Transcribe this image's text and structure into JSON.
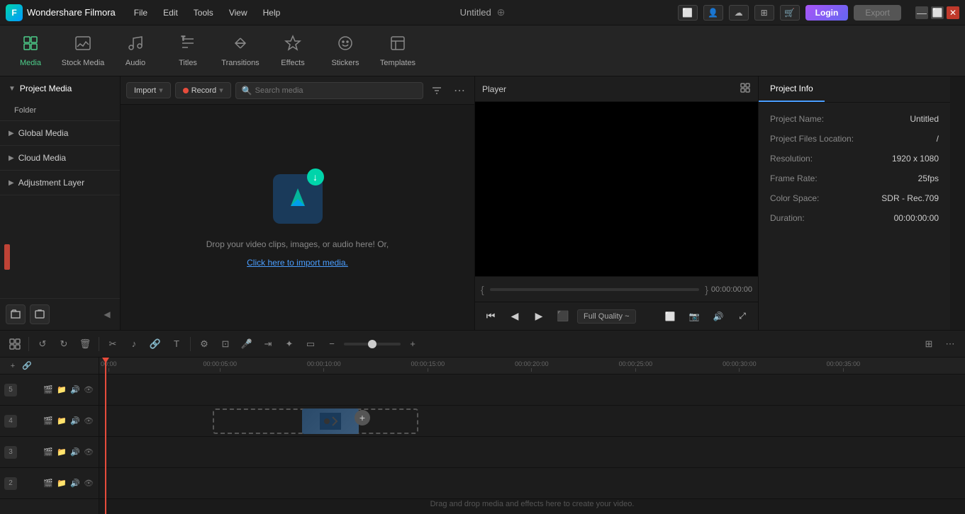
{
  "app": {
    "name": "Wondershare Filmora",
    "title": "Untitled"
  },
  "menu": {
    "items": [
      "File",
      "Edit",
      "Tools",
      "View",
      "Help"
    ]
  },
  "titlebar": {
    "login_label": "Login",
    "export_label": "Export"
  },
  "toolbar": {
    "items": [
      {
        "id": "media",
        "label": "Media",
        "icon": "▦",
        "active": true
      },
      {
        "id": "stock-media",
        "label": "Stock Media",
        "icon": "🎵"
      },
      {
        "id": "audio",
        "label": "Audio",
        "icon": "♫"
      },
      {
        "id": "titles",
        "label": "Titles",
        "icon": "T"
      },
      {
        "id": "transitions",
        "label": "Transitions",
        "icon": "⇌"
      },
      {
        "id": "effects",
        "label": "Effects",
        "icon": "✦"
      },
      {
        "id": "stickers",
        "label": "Stickers",
        "icon": "●"
      },
      {
        "id": "templates",
        "label": "Templates",
        "icon": "⊡"
      }
    ]
  },
  "left_panel": {
    "project_media_label": "Project Media",
    "folder_label": "Folder",
    "global_media_label": "Global Media",
    "cloud_media_label": "Cloud Media",
    "adjustment_layer_label": "Adjustment Layer"
  },
  "media_panel": {
    "import_label": "Import",
    "record_label": "Record",
    "search_placeholder": "Search media",
    "drop_text": "Drop your video clips, images, or audio here! Or,",
    "drop_link": "Click here to import media."
  },
  "player": {
    "title": "Player",
    "time": "00:00:00:00",
    "quality_label": "Full Quality ~"
  },
  "project_info": {
    "tab_label": "Project Info",
    "fields": [
      {
        "label": "Project Name:",
        "value": "Untitled"
      },
      {
        "label": "Project Files Location:",
        "value": "/"
      },
      {
        "label": "Resolution:",
        "value": "1920 x 1080"
      },
      {
        "label": "Frame Rate:",
        "value": "25fps"
      },
      {
        "label": "Color Space:",
        "value": "SDR - Rec.709"
      },
      {
        "label": "Duration:",
        "value": "00:00:00:00"
      }
    ]
  },
  "timeline": {
    "ruler_marks": [
      "00:00",
      "00:00:05:00",
      "00:00:10:00",
      "00:00:15:00",
      "00:00:20:00",
      "00:00:25:00",
      "00:00:30:00",
      "00:00:35:00"
    ],
    "drop_prompt": "Drag and drop media and effects here to create your video.",
    "tracks": [
      {
        "num": "5"
      },
      {
        "num": "4"
      },
      {
        "num": "3"
      },
      {
        "num": "2"
      }
    ]
  }
}
